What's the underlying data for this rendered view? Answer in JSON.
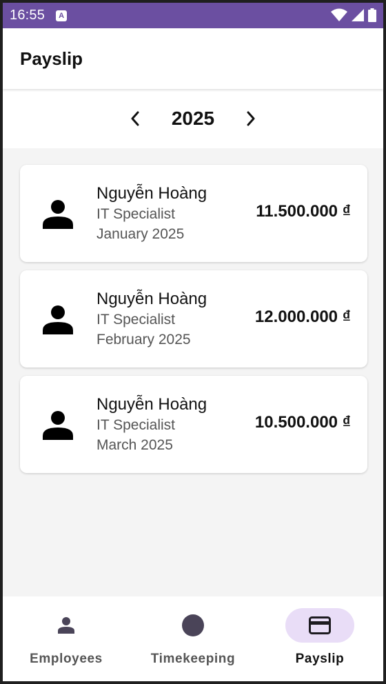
{
  "status_bar": {
    "time": "16:55",
    "notification_icon": "A"
  },
  "app_bar": {
    "title": "Payslip"
  },
  "year_selector": {
    "year": "2025",
    "prev_icon": "chevron-left-icon",
    "next_icon": "chevron-right-icon"
  },
  "payslips": [
    {
      "name": "Nguyễn Hoàng",
      "role": "IT Specialist",
      "period": "January 2025",
      "amount": "11.500.000 ₫"
    },
    {
      "name": "Nguyễn Hoàng",
      "role": "IT Specialist",
      "period": "February 2025",
      "amount": "12.000.000 ₫"
    },
    {
      "name": "Nguyễn Hoàng",
      "role": "IT Specialist",
      "period": "March 2025",
      "amount": "10.500.000 ₫"
    }
  ],
  "bottom_nav": {
    "items": [
      {
        "label": "Employees",
        "icon": "person-icon",
        "active": false
      },
      {
        "label": "Timekeeping",
        "icon": "circle-icon",
        "active": false
      },
      {
        "label": "Payslip",
        "icon": "credit-card-icon",
        "active": true
      }
    ]
  },
  "colors": {
    "status_bar": "#6b4fa1",
    "active_pill": "#e9ddf7",
    "background": "#f4f4f4"
  }
}
